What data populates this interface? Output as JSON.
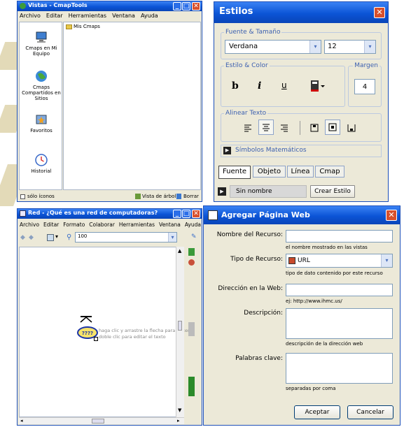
{
  "colors": {
    "titlebar": "#0b54d6",
    "close": "#d8502c",
    "panel": "#ece9d8",
    "accent_label": "#3b5fb0"
  },
  "vistas": {
    "title": "Vistas - CmapTools",
    "menu": [
      "Archivo",
      "Editar",
      "Herramientas",
      "Ventana",
      "Ayuda"
    ],
    "sidebar": [
      {
        "label": "Cmaps en Mi Equipo",
        "icon": "computer-icon"
      },
      {
        "label": "Cmaps Compartidos en Sitios",
        "icon": "globe-icon"
      },
      {
        "label": "Favoritos",
        "icon": "favorites-icon"
      },
      {
        "label": "Historial",
        "icon": "history-icon"
      }
    ],
    "folder_label": "Mis Cmaps",
    "only_icons": "sólo íconos",
    "tree_view": "Vista de árbol",
    "delete": "Borrar"
  },
  "estilos": {
    "title": "Estilos",
    "font_group": "Fuente & Tamaño",
    "font_value": "Verdana",
    "size_value": "12",
    "style_group": "Estilo & Color",
    "bold": "b",
    "italic": "i",
    "underline": "u",
    "margin_group": "Margen",
    "margin_value": "4",
    "align_group": "Alinear Texto",
    "math_symbols": "Símbolos Matemáticos",
    "tabs": [
      "Fuente",
      "Objeto",
      "Línea",
      "Cmap"
    ],
    "style_name": "Sin nombre",
    "create_style": "Crear Estilo"
  },
  "red": {
    "title": "Red - ¿Qué es una red de computadoras?",
    "menu": [
      "Archivo",
      "Editar",
      "Formato",
      "Colaborar",
      "Herramientas",
      "Ventana",
      "Ayuda"
    ],
    "zoom": "100",
    "concept": "????",
    "hint_line1": "haga clic y arrastre la flecha para hacer",
    "hint_line2": "doble clic para editar el texto"
  },
  "web": {
    "title": "Agregar Página Web",
    "resource_name_label": "Nombre del Recurso:",
    "resource_name_value": "",
    "resource_name_hint": "el nombre mostrado en las vistas",
    "resource_type_label": "Tipo de Recurso:",
    "resource_type_value": "URL",
    "resource_type_hint": "tipo de dato contenido por este recurso",
    "address_label": "Dirección en la Web:",
    "address_value": "",
    "address_hint": "ej: http://www.ihmc.us/",
    "description_label": "Descripción:",
    "description_value": "",
    "description_hint": "descripción de la dirección web",
    "keywords_label": "Palabras clave:",
    "keywords_value": "",
    "keywords_hint": "separadas por coma",
    "accept": "Aceptar",
    "cancel": "Cancelar"
  }
}
